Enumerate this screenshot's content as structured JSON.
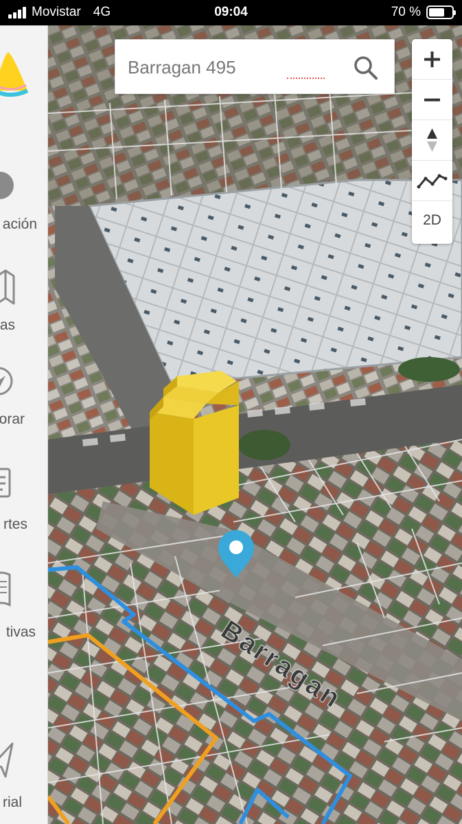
{
  "status_bar": {
    "carrier": "Movistar",
    "network": "4G",
    "time": "09:04",
    "battery_percent": "70 %",
    "battery_level": 0.7
  },
  "search": {
    "value": "Barragan 495",
    "icon": "search-icon"
  },
  "map_controls": {
    "zoom_in": "+",
    "zoom_out": "−",
    "view_2d": "2D"
  },
  "map": {
    "street_name": "Barragan",
    "building_color": "#e7c21e",
    "pin_color": "#3aa8d8",
    "boundary_colors": [
      "#2f8fdf",
      "#f0a020"
    ]
  },
  "sidebar": {
    "items": [
      {
        "label": "ación",
        "icon": "location-icon"
      },
      {
        "label": "as",
        "icon": "map-icon"
      },
      {
        "label": "orar",
        "icon": "compass-icon"
      },
      {
        "label": "rtes",
        "icon": "report-icon"
      },
      {
        "label": "tivas",
        "icon": "book-icon"
      },
      {
        "label": "rial",
        "icon": "send-icon"
      }
    ]
  }
}
